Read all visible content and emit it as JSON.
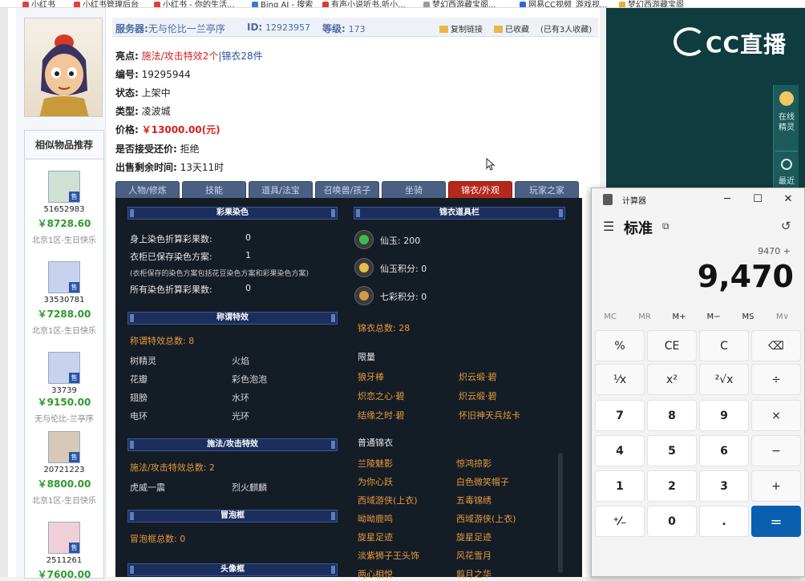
{
  "bookmarks": [
    {
      "label": "小红书",
      "color": "#e24040"
    },
    {
      "label": "小红书管理后台",
      "color": "#e24040"
    },
    {
      "label": "小红书 - 你的生活...",
      "color": "#e24040"
    },
    {
      "label": "Bing AI - 搜索",
      "color": "#3a7ad8"
    },
    {
      "label": "有声小说听书,听小...",
      "color": "#d83a3a"
    },
    {
      "label": "梦幻西游藏宝阁...",
      "color": "#999999"
    },
    {
      "label": "网易CC视频_游戏视...",
      "color": "#2a6ad8"
    },
    {
      "label": "梦幻西游藏宝阁",
      "color": "#e0b030"
    }
  ],
  "listing": {
    "server_label": "服务器:",
    "server_value": "无与伦比一兰亭序",
    "id_label": "ID:",
    "id_value": "12923957",
    "level_label": "等级:",
    "level_value": "173",
    "copy_link": "复制链接",
    "favorited": "已收藏",
    "fav_count": "(已有3人收藏)",
    "highlight_label": "亮点:",
    "highlight_red": "施法/攻击特效2个",
    "highlight_blue": "|锦衣28件",
    "serial_label": "编号:",
    "serial_value": "19295944",
    "status_label": "状态:",
    "status_value": "上架中",
    "type_label": "类型:",
    "type_value": "凌波城",
    "price_label": "价格:",
    "price_value": "￥13000.00(元)",
    "counter_label": "是否接受还价:",
    "counter_value": "拒绝",
    "remain_label": "出售剩余时间:",
    "remain_value": "13天11时"
  },
  "similar": {
    "title": "相似物品推荐",
    "badge": "售",
    "items": [
      {
        "id": "51652983",
        "price": "￥8728.60",
        "server": "北京1区-生日快乐"
      },
      {
        "id": "33530781",
        "price": "￥7288.00",
        "server": "北京1区-生日快乐"
      },
      {
        "id": "33739",
        "price": "￥9150.00",
        "server": "无与伦比-兰亭序"
      },
      {
        "id": "20721223",
        "price": "￥8800.00",
        "server": "北京1区-生日快乐"
      },
      {
        "id": "2511261",
        "price": "￥7600.00",
        "server": ""
      }
    ]
  },
  "tabs": [
    "人物/修炼",
    "技能",
    "道具/法宝",
    "召唤兽/孩子",
    "坐骑",
    "锦衣/外观",
    "玩家之家"
  ],
  "panel": {
    "dye_head": "彩果染色",
    "dye_rows": [
      {
        "label": "身上染色折算彩果数:",
        "value": "0"
      },
      {
        "label": "衣柜已保存染色方案:",
        "value": "1"
      }
    ],
    "dye_note": "(衣柜保存的染色方案包括花豆染色方案和彩果染色方案)",
    "dye_total_label": "所有染色折算彩果数:",
    "dye_total_value": "0",
    "title_head": "称谓特效",
    "title_count": "称谓特效总数: 8",
    "title_effects": [
      "树精灵",
      "火焰",
      "花瓣",
      "彩色泡泡",
      "翅膀",
      "水环",
      "电环",
      "光环"
    ],
    "cast_head": "施法/攻击特效",
    "cast_count": "施法/攻击特效总数: 2",
    "cast_effects": [
      "虎威一震",
      "烈火麒麟"
    ],
    "bubble_head": "冒泡框",
    "bubble_count": "冒泡框总数: 0",
    "avatar_head": "头像框",
    "wardrobe_head": "锦衣道具栏",
    "xianyu": "仙玉: 200",
    "xianyu_points": "仙玉积分: 0",
    "qicai_points": "七彩积分: 0",
    "jinyi_total": "锦衣总数: 28",
    "limited_head": "限量",
    "limited": [
      "狼牙棒",
      "炽云缎·碧",
      "炽恋之心·碧",
      "炽云缎·碧",
      "结缘之时·碧",
      "怀旧神天兵炫卡"
    ],
    "normal_head": "普通锦衣",
    "normal": [
      "兰陵魅影",
      "惊鸿掠影",
      "为你心跃",
      "白色微笑帽子",
      "西域游侠(上衣)",
      "五毒锦绣",
      "呦呦鹿鸣",
      "西域游侠(上衣)",
      "旋星足迹",
      "旋星足迹",
      "淡紫狮子王头饰",
      "风花雪月",
      "两心相悦",
      "翦月之华"
    ]
  },
  "cc": {
    "logo": "CC直播",
    "side_btn1": "在线精灵",
    "side_btn2": "最近"
  },
  "calc": {
    "title": "计算器",
    "mode": "标准",
    "expression": "9470 +",
    "display": "9,470",
    "memory": [
      "MC",
      "MR",
      "M+",
      "M−",
      "MS",
      "M∨"
    ],
    "keys": [
      "%",
      "CE",
      "C",
      "⌫",
      "¹⁄x",
      "x²",
      "²√x",
      "÷",
      "7",
      "8",
      "9",
      "×",
      "4",
      "5",
      "6",
      "−",
      "1",
      "2",
      "3",
      "+",
      "⁺⁄₋",
      "0",
      ".",
      "="
    ]
  }
}
